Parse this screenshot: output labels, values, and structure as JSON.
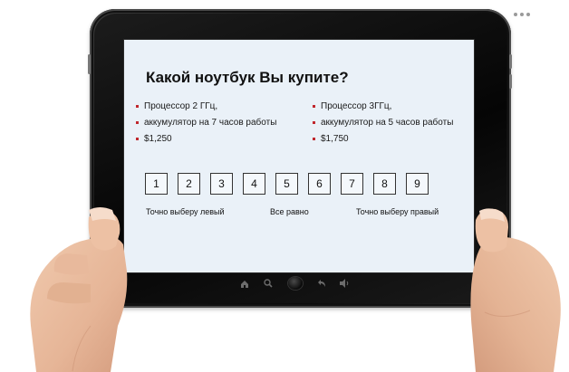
{
  "slide": {
    "title": "Какой ноутбук Вы купите?",
    "left_option": [
      "Процессор 2 ГГц,",
      "аккумулятор на 7 часов работы",
      "$1,250"
    ],
    "right_option": [
      "Процессор 3ГГц,",
      "аккумулятор на 5 часов работы",
      "$1,750"
    ],
    "scale": [
      "1",
      "2",
      "3",
      "4",
      "5",
      "6",
      "7",
      "8",
      "9"
    ],
    "labels": {
      "left": "Точно выберу левый",
      "middle": "Все равно",
      "right": "Точно выберу правый"
    }
  },
  "colors": {
    "screen_bg": "#eaf1f8",
    "bullet": "#c0272d",
    "bezel": "#0b0b0b"
  },
  "nav_icons": [
    "home-icon",
    "search-icon",
    "home-button",
    "back-icon",
    "volume-icon"
  ]
}
